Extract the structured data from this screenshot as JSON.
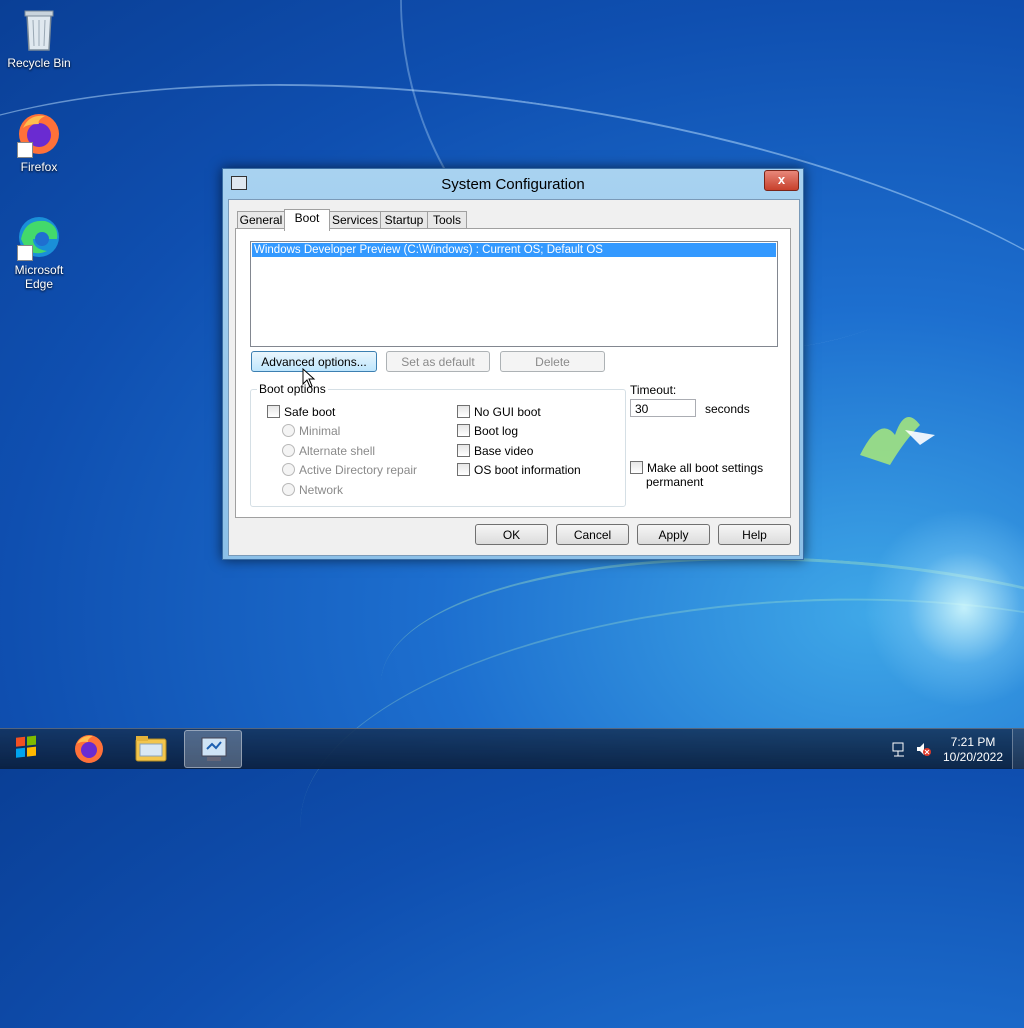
{
  "desktop": {
    "icons": [
      {
        "label": "Recycle Bin",
        "icon": "recycle-bin-icon"
      },
      {
        "label": "Firefox",
        "icon": "firefox-icon"
      },
      {
        "label_line1": "Microsoft",
        "label_line2": "Edge",
        "icon": "edge-icon"
      }
    ]
  },
  "window": {
    "title": "System Configuration",
    "close_label": "x",
    "tabs": [
      {
        "label": "General"
      },
      {
        "label": "Boot",
        "active": true
      },
      {
        "label": "Services"
      },
      {
        "label": "Startup"
      },
      {
        "label": "Tools"
      }
    ],
    "boot": {
      "os_entries": [
        "Windows Developer Preview (C:\\Windows) : Current OS; Default OS"
      ],
      "advanced_button": "Advanced options...",
      "set_default_button": "Set as default",
      "delete_button": "Delete",
      "boot_options_label": "Boot options",
      "safe_boot": "Safe boot",
      "radios": [
        "Minimal",
        "Alternate shell",
        "Active Directory repair",
        "Network"
      ],
      "right_checks": [
        "No GUI boot",
        "Boot log",
        "Base video",
        "OS boot information"
      ],
      "timeout_label": "Timeout:",
      "timeout_value": "30",
      "seconds_label": "seconds",
      "permanent_line1": "Make all boot settings",
      "permanent_line2": "permanent"
    },
    "buttons": {
      "ok": "OK",
      "cancel": "Cancel",
      "apply": "Apply",
      "help": "Help"
    }
  },
  "taskbar": {
    "clock_time": "7:21 PM",
    "clock_date": "10/20/2022",
    "items": [
      "start-button",
      "firefox",
      "file-explorer",
      "system-configuration"
    ]
  },
  "colors": {
    "selection": "#3399ff",
    "accent": "#1d6fcf",
    "close": "#c7402c"
  }
}
